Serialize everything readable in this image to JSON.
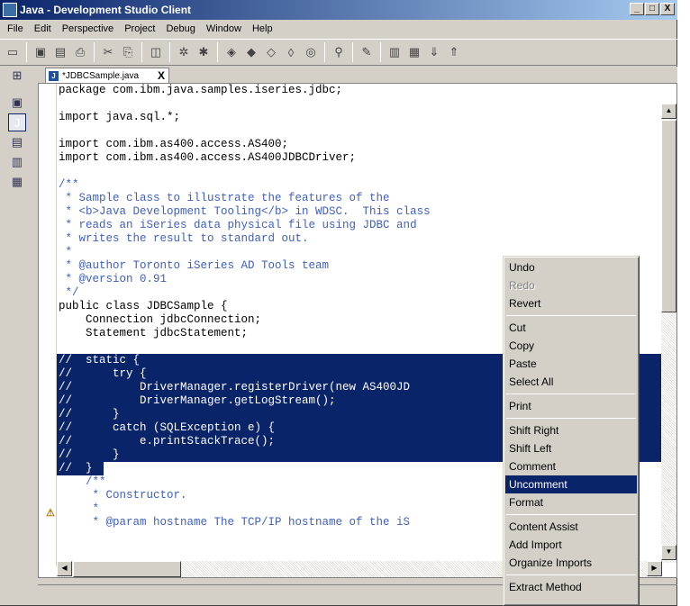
{
  "window": {
    "title": "Java - Development Studio Client",
    "min": "_",
    "max": "□",
    "close": "X"
  },
  "menubar": [
    "File",
    "Edit",
    "Perspective",
    "Project",
    "Debug",
    "Window",
    "Help"
  ],
  "tab": {
    "label": "*JDBCSample.java",
    "close": "X"
  },
  "code": {
    "l1": "package com.ibm.java.samples.iseries.jdbc;",
    "l2": "import java.sql.*;",
    "l3": "import com.ibm.as400.access.AS400;",
    "l4": "import com.ibm.as400.access.AS400JDBCDriver;",
    "l5": "/**",
    "l6": " * Sample class to illustrate the features of the",
    "l7": " * <b>Java Development Tooling</b> in WDSC.  This class",
    "l8": " * reads an iSeries data physical file using JDBC and",
    "l9": " * writes the result to standard out.",
    "l10": " *",
    "l11": " * @author Toronto iSeries AD Tools team",
    "l12": " * @version 0.91",
    "l13": " */",
    "l14": "public class JDBCSample {",
    "l15": "    Connection jdbcConnection;",
    "l16": "    Statement jdbcStatement;",
    "s1": "//  static {",
    "s2": "//      try {",
    "s3": "//          DriverManager.registerDriver(new AS400JD",
    "s4": "//          DriverManager.getLogStream();",
    "s5": "//      }",
    "s6": "//      catch (SQLException e) {",
    "s7": "//          e.printStackTrace();",
    "s8": "//      }",
    "s9": "//  }",
    "l17": "    /**",
    "l18": "     * Constructor.",
    "l19": "     *",
    "l20": "     * @param hostname The TCP/IP hostname of the iS"
  },
  "contextMenu": {
    "undo": "Undo",
    "redo": "Redo",
    "revert": "Revert",
    "cut": "Cut",
    "copy": "Copy",
    "paste": "Paste",
    "selectAll": "Select All",
    "print": "Print",
    "shiftRight": "Shift Right",
    "shiftLeft": "Shift Left",
    "comment": "Comment",
    "uncomment": "Uncomment",
    "format": "Format",
    "contentAssist": "Content Assist",
    "addImport": "Add Import",
    "organizeImports": "Organize Imports",
    "extractMethod": "Extract Method"
  }
}
